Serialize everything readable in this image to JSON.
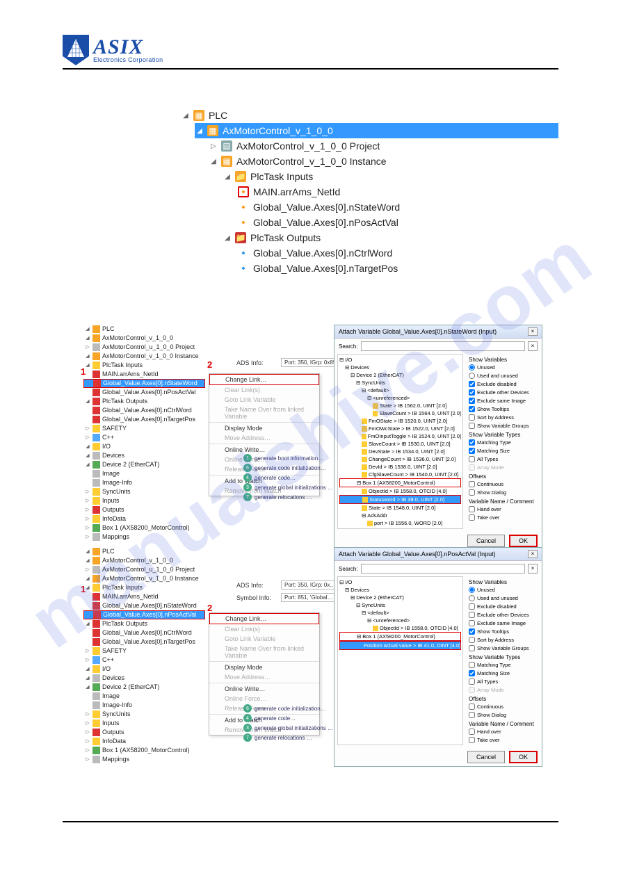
{
  "logo": {
    "brand": "ASIX",
    "tagline": "Electronics Corporation"
  },
  "watermark": "manualshive.com",
  "bigtree": {
    "plc": "PLC",
    "proj_root": "AxMotorControl_v_1_0_0",
    "project": "AxMotorControl_v_1_0_0 Project",
    "instance": "AxMotorControl_v_1_0_0 Instance",
    "inputs": "PlcTask Inputs",
    "in0": "MAIN.arrAms_NetId",
    "in1": "Global_Value.Axes[0].nStateWord",
    "in2": "Global_Value.Axes[0].nPosActVal",
    "outputs": "PlcTask Outputs",
    "out0": "Global_Value.Axes[0].nCtrlWord",
    "out1": "Global_Value.Axes[0].nTargetPos"
  },
  "shotA": {
    "tree": {
      "plc": "PLC",
      "root": "AxMotorControl_v_1_0_0",
      "project": "AxMotorControl_u_1_0_0 Project",
      "instance": "AxMotorControl_v_1_0_0 Instance",
      "inputs": "PlcTask Inputs",
      "in0": "MAIN.arrAms_NetId",
      "in1": "Global_Value.Axes[0].nStateWord",
      "in2": "Global_Value.Axes[0].nPosActVal",
      "outputs": "PlcTask Outputs",
      "out0": "Global_Value.Axes[0].nCtrlWord",
      "out1": "Global_Value.Axes[0].nTargetPos",
      "safety": "SAFETY",
      "cpp": "C++",
      "io": "I/O",
      "devices": "Devices",
      "dev2": "Device 2 (EtherCAT)",
      "img": "Image",
      "imginfo": "Image-Info",
      "sync": "SyncUnits",
      "inp": "Inputs",
      "outp": "Outputs",
      "infodata": "InfoData",
      "box1": "Box 1 (AX58200_MotorControl)",
      "maps": "Mappings"
    },
    "ads": {
      "label": "ADS Info:",
      "value": "Port: 350, IGrp: 0x85…"
    },
    "menu": {
      "change": "Change Link…",
      "clear": "Clear Link(s)",
      "goto": "Goto Link Variable",
      "take": "Take Name Over from linked Variable",
      "display": "Display Mode",
      "move": "Move Address…",
      "online": "Online Write…",
      "force": "Online Force…",
      "release": "Release Force",
      "watch": "Add to Watch",
      "remove": "Remove from Watch"
    },
    "botlist": {
      "b1": "generate boot information…",
      "b2": "generate code initialization…",
      "b3": "generate code…",
      "b4": "generate global initializations …",
      "b5": "generate relocations …"
    },
    "dialog": {
      "title": "Attach Variable Global_Value.Axes[0].nStateWord (Input)",
      "search": "Search:",
      "tree": {
        "io": "I/O",
        "devices": "Devices",
        "dev2": "Device 2 (EtherCAT)",
        "sync": "SyncUnits",
        "def": "<default>",
        "unref": "<unreferenced>",
        "state": "State  >  IB 1562.0, UINT [2.0]",
        "slavecnt": "SlaveCount  >  IB 1564.0, UINT [2.0]",
        "fmo": "FmOState  >  IB 1520.0, UINT [2.0]",
        "fmows": "FmOWcState  >  IB 1522.0, UINT [2.0]",
        "fmot": "FmOInputToggle  >  IB 1524.0, UINT [2.0]",
        "slc2": "SlaveCount  >  IB 1530.0, UINT [2.0]",
        "devst": "DevState  >  IB 1534.0, UINT [2.0]",
        "chg": "ChangeCount  >  IB 1536.0, UINT [2.0]",
        "devid": "DevId  >  IB 1538.0, UINT [2.0]",
        "cfgsc": "CfgSlaveCount  >  IB 1540.0, UINT [2.0]",
        "box1": "Box 1 (AX58200_MotorControl)",
        "objid": "ObjectId  >  IB 1558.0, OTCID [4.0]",
        "stw": "Statusword  >  IB 39.0, UINT [2.0]",
        "state2": "State  >  IB 1548.0, UINT [2.0]",
        "ads": "AdsAddr",
        "port": "port  >  IB 1556.0, WORD [2.0]"
      },
      "opts": {
        "showvar": "Show Variables",
        "unused": "Unused",
        "usedun": "Used and unused",
        "excldis": "Exclude disabled",
        "exclother": "Exclude other Devices",
        "exclsame": "Exclude same Image",
        "tooltips": "Show Tooltips",
        "sortaddr": "Sort by Address",
        "showgrp": "Show Variable Groups",
        "showtypes": "Show Variable Types",
        "mtype": "Matching Type",
        "msize": "Matching Size",
        "alltypes": "All Types",
        "arrmode": "Array Mode",
        "offsets": "Offsets",
        "cont": "Continuous",
        "showdlg": "Show Dialog",
        "varname": "Variable Name / Comment",
        "handover": "Hand over",
        "takeover": "Take over"
      },
      "cancel": "Cancel",
      "ok": "OK"
    },
    "nums": {
      "n1": "1",
      "n2": "2",
      "n3": "3",
      "n4": "4"
    }
  },
  "shotB": {
    "tree": {
      "in_sel": "Global_Value.Axes[0].nPosActVal"
    },
    "ads": {
      "label": "ADS Info:",
      "value": "Port: 350, IGrp: 0x…"
    },
    "sym": {
      "label": "Symbol Info:",
      "value": "Port: 851, 'Global…"
    },
    "dialog": {
      "title": "Attach Variable Global_Value.Axes[0].nPosActVal (Input)",
      "tree": {
        "io": "I/O",
        "devices": "Devices",
        "dev2": "Device 2 (EtherCAT)",
        "sync": "SyncUnits",
        "def": "<default>",
        "unref": "<unreferenced>",
        "objid": "ObjectId  >  IB 1558.0, OTCID [4.0]",
        "box1": "Box 1 (AX58200_MotorControl)",
        "pav": "Position actual value  >  IB 41.0, DINT [4.0]"
      }
    }
  }
}
